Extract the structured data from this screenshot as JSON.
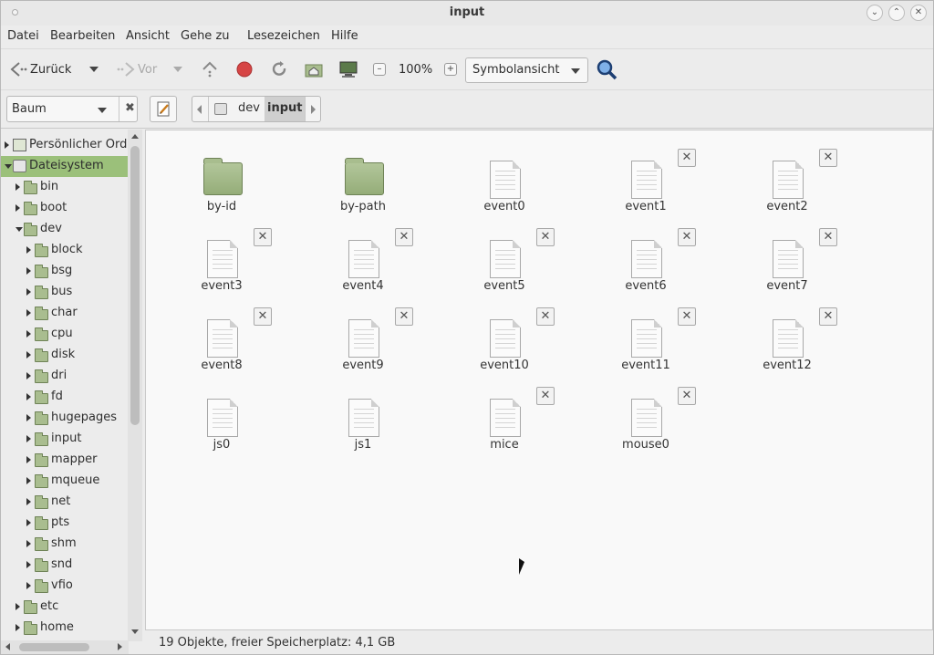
{
  "window": {
    "title": "input"
  },
  "menu": [
    "Datei",
    "Bearbeiten",
    "Ansicht",
    "Gehe zu",
    "Lesezeichen",
    "Hilfe"
  ],
  "toolbar": {
    "back_label": "Zurück",
    "forward_label": "Vor",
    "zoom_value": "100%",
    "view_mode": "Symbolansicht"
  },
  "location": {
    "sidebar_mode": "Baum",
    "crumbs": [
      "dev",
      "input"
    ]
  },
  "sidebar": {
    "items": [
      {
        "label": "Persönlicher Ordner",
        "icon": "home-icon",
        "expanded": false
      },
      {
        "label": "Dateisystem",
        "icon": "disk-icon",
        "expanded": true,
        "selected": true
      },
      {
        "label": "bin",
        "icon": "folder-icon",
        "expanded": false
      },
      {
        "label": "boot",
        "icon": "folder-icon",
        "expanded": false
      },
      {
        "label": "dev",
        "icon": "folder-icon",
        "expanded": true
      },
      {
        "label": "block",
        "icon": "folder-icon",
        "expanded": false
      },
      {
        "label": "bsg",
        "icon": "folder-icon",
        "expanded": false
      },
      {
        "label": "bus",
        "icon": "folder-icon",
        "expanded": false
      },
      {
        "label": "char",
        "icon": "folder-icon",
        "expanded": false
      },
      {
        "label": "cpu",
        "icon": "folder-icon",
        "expanded": false
      },
      {
        "label": "disk",
        "icon": "folder-icon",
        "expanded": false
      },
      {
        "label": "dri",
        "icon": "folder-icon",
        "expanded": false
      },
      {
        "label": "fd",
        "icon": "folder-link-icon",
        "expanded": false
      },
      {
        "label": "hugepages",
        "icon": "folder-icon",
        "expanded": false
      },
      {
        "label": "input",
        "icon": "folder-icon",
        "expanded": false
      },
      {
        "label": "mapper",
        "icon": "folder-icon",
        "expanded": false
      },
      {
        "label": "mqueue",
        "icon": "folder-icon",
        "expanded": false
      },
      {
        "label": "net",
        "icon": "folder-icon",
        "expanded": false
      },
      {
        "label": "pts",
        "icon": "folder-icon",
        "expanded": false
      },
      {
        "label": "shm",
        "icon": "folder-icon",
        "expanded": false
      },
      {
        "label": "snd",
        "icon": "folder-icon",
        "expanded": false
      },
      {
        "label": "vfio",
        "icon": "folder-icon",
        "expanded": false
      },
      {
        "label": "etc",
        "icon": "folder-icon",
        "expanded": false
      },
      {
        "label": "home",
        "icon": "folder-icon",
        "expanded": false
      }
    ]
  },
  "files": [
    {
      "name": "by-id",
      "type": "folder",
      "locked": false
    },
    {
      "name": "by-path",
      "type": "folder",
      "locked": false
    },
    {
      "name": "event0",
      "type": "file",
      "locked": false
    },
    {
      "name": "event1",
      "type": "file",
      "locked": true
    },
    {
      "name": "event2",
      "type": "file",
      "locked": true
    },
    {
      "name": "event3",
      "type": "file",
      "locked": true
    },
    {
      "name": "event4",
      "type": "file",
      "locked": true
    },
    {
      "name": "event5",
      "type": "file",
      "locked": true
    },
    {
      "name": "event6",
      "type": "file",
      "locked": true
    },
    {
      "name": "event7",
      "type": "file",
      "locked": true
    },
    {
      "name": "event8",
      "type": "file",
      "locked": true
    },
    {
      "name": "event9",
      "type": "file",
      "locked": true
    },
    {
      "name": "event10",
      "type": "file",
      "locked": true
    },
    {
      "name": "event11",
      "type": "file",
      "locked": true
    },
    {
      "name": "event12",
      "type": "file",
      "locked": true
    },
    {
      "name": "js0",
      "type": "file",
      "locked": false
    },
    {
      "name": "js1",
      "type": "file",
      "locked": false
    },
    {
      "name": "mice",
      "type": "file",
      "locked": true
    },
    {
      "name": "mouse0",
      "type": "file",
      "locked": true
    }
  ],
  "status": {
    "text": "19 Objekte, freier Speicherplatz: 4,1 GB"
  },
  "colors": {
    "selection": "#9bc07a",
    "folder": "#a9bd8f",
    "stop": "#d64545"
  }
}
